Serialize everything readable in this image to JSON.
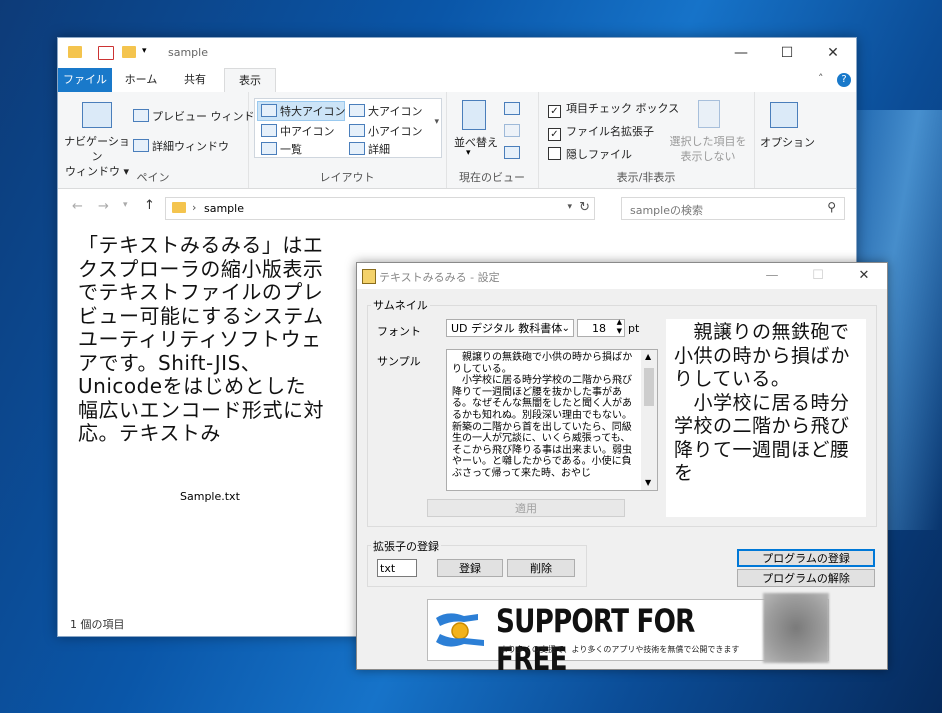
{
  "explorer": {
    "title": "sample",
    "window_controls": {
      "minimize": "—",
      "maximize": "☐",
      "close": "✕"
    },
    "tabs": [
      {
        "label": "ファイル"
      },
      {
        "label": "ホーム"
      },
      {
        "label": "共有"
      },
      {
        "label": "表示"
      }
    ],
    "ribbon": {
      "pane_group": {
        "nav_pane": "ナビゲーション\nウィンドウ ▾",
        "preview_pane": "プレビュー ウィンドウ",
        "details_pane": "詳細ウィンドウ",
        "label": "ペイン"
      },
      "layout_group": {
        "items": [
          "特大アイコン",
          "大アイコン",
          "中アイコン",
          "小アイコン",
          "一覧",
          "詳細"
        ],
        "label": "レイアウト"
      },
      "current_view_group": {
        "sort_by": "並べ替え",
        "label": "現在のビュー"
      },
      "show_hide_group": {
        "item_checkbox": "項目チェック ボックス",
        "extensions": "ファイル名拡張子",
        "hidden_files": "隠しファイル",
        "hide_selected": "選択した項目を\n表示しない",
        "label": "表示/非表示"
      },
      "options": "オプション"
    },
    "address": {
      "path": "sample",
      "search_placeholder": "sampleの検索"
    },
    "preview_text": "「テキストみるみる」はエクスプローラの縮小版表示でテキストファイルのプレビュー可能にするシステムユーティリティソフトウェアです。Shift-JIS、Unicodeをはじめとした幅広いエンコード形式に対応。テキストみ",
    "file_name": "Sample.txt",
    "status": "1 個の項目"
  },
  "dialog": {
    "title": "テキストみるみる - 設定",
    "thumbnail_group": "サムネイル",
    "font_label": "フォント",
    "font_value": "UD デジタル 教科書体",
    "size_value": "18",
    "size_unit": "pt",
    "sample_label": "サンプル",
    "sample_text": "　親譲りの無鉄砲で小供の時から損ばかりしている。\n　小学校に居る時分学校の二階から飛び降りて一週間ほど腰を抜かした事がある。なぜそんな無闇をしたと聞く人があるかも知れぬ。別段深い理由でもない。新築の二階から首を出していたら、同級生の一人が冗談に、いくら威張っても、そこから飛び降りる事は出来まい。弱虫やーい。と囃したからである。小使に負ぶさって帰って来た時、おやじ",
    "preview_text": "　親譲りの無鉄砲で小供の時から損ばかりしている。\n　小学校に居る時分学校の二階から飛び降りて一週間ほど腰を",
    "apply_button": "適用",
    "ext_group": "拡張子の登録",
    "ext_value": "txt",
    "register_button": "登録",
    "delete_button": "削除",
    "register_program_button": "プログラムの登録",
    "unregister_program_button": "プログラムの解除",
    "banner_title": "SUPPORT FOR FREE",
    "banner_subtitle": "より多くの支援で、より多くのアプリや技術を無償で公開できます"
  },
  "colors": {
    "accent": "#1979ca",
    "focus": "#0078d7",
    "folder": "#f4c44e"
  }
}
